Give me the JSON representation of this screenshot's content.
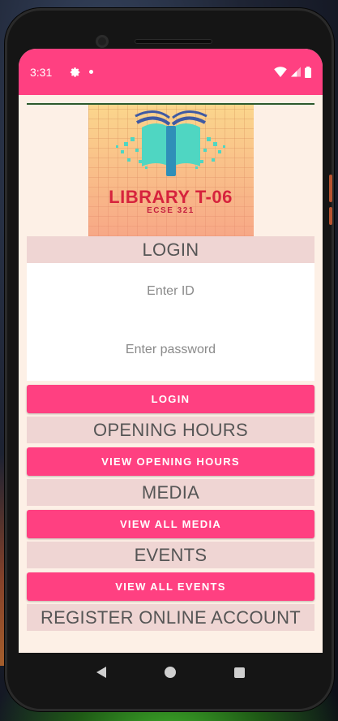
{
  "status_bar": {
    "time": "3:31",
    "icons": [
      "settings-icon",
      "notification-dot-icon",
      "wifi-icon",
      "signal-icon",
      "battery-icon"
    ]
  },
  "logo": {
    "title": "LIBRARY T-06",
    "subtitle": "ECSE 321"
  },
  "login": {
    "header": "LOGIN",
    "id_placeholder": "Enter ID",
    "id_value": "",
    "password_placeholder": "Enter password",
    "password_value": "",
    "button": "LOGIN"
  },
  "opening_hours": {
    "header": "OPENING HOURS",
    "button": "VIEW OPENING HOURS"
  },
  "media": {
    "header": "MEDIA",
    "button": "VIEW ALL MEDIA"
  },
  "events": {
    "header": "EVENTS",
    "button": "VIEW ALL EVENTS"
  },
  "register": {
    "header": "REGISTER ONLINE ACCOUNT"
  },
  "colors": {
    "accent": "#ff4081",
    "section_header_bg": "#efd5d3",
    "page_bg": "#fdf0e6"
  },
  "nav": {
    "icons": [
      "back-icon",
      "home-icon",
      "recents-icon"
    ]
  }
}
